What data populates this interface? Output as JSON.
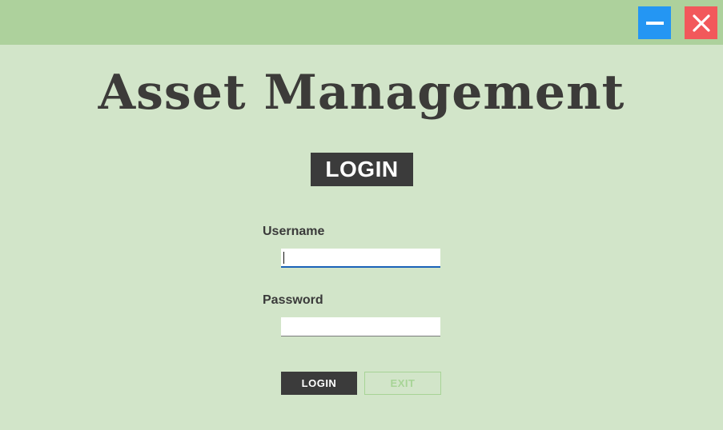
{
  "window": {
    "minimize_icon": "minimize-icon",
    "close_icon": "close-icon",
    "minimize_color": "#2496f3",
    "close_color": "#f2585b",
    "titlebar_color": "#add19c",
    "background_color": "#d2e5c9"
  },
  "app": {
    "title": "Asset Management"
  },
  "login": {
    "heading": "LOGIN",
    "username_label": "Username",
    "username_value": "",
    "password_label": "Password",
    "password_value": "",
    "login_button": "LOGIN",
    "exit_button": "EXIT"
  }
}
